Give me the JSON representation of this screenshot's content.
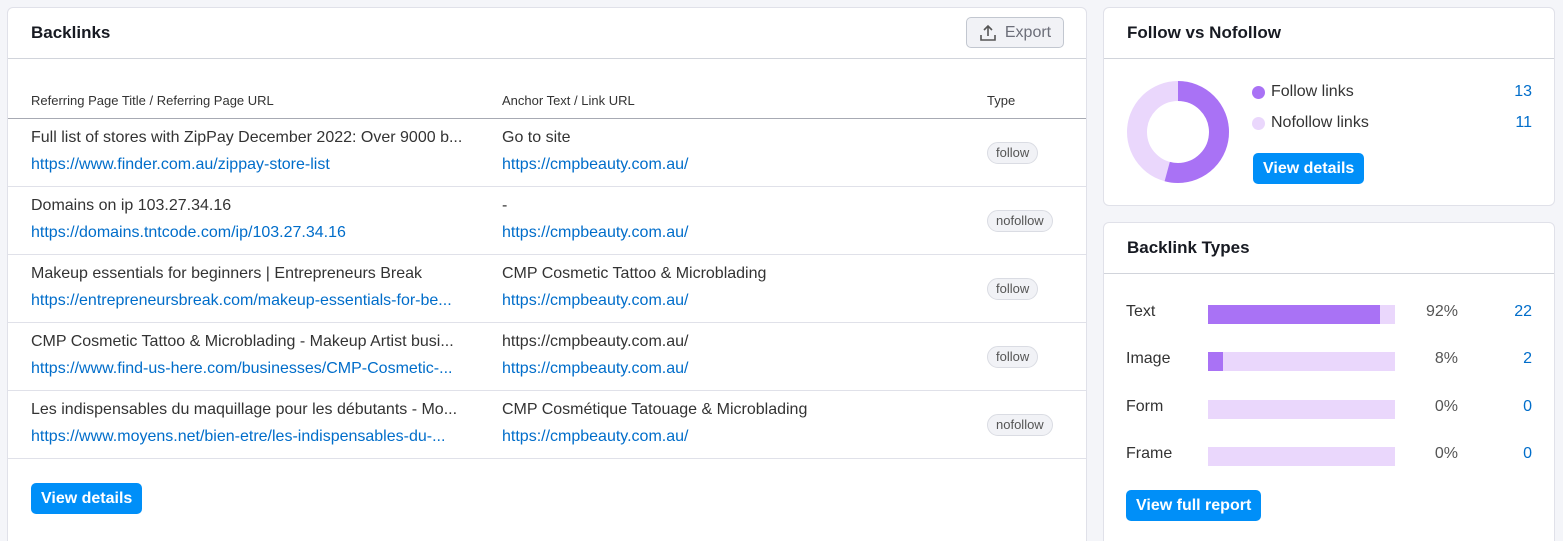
{
  "backlinks": {
    "title": "Backlinks",
    "export_label": "Export",
    "columns": [
      "Referring Page Title / Referring Page URL",
      "Anchor Text / Link URL",
      "Type"
    ],
    "rows": [
      {
        "title": "Full list of stores with ZipPay December 2022: Over 9000 b...",
        "url": "https://www.finder.com.au/zippay-store-list",
        "anchor": "Go to site",
        "link": "https://cmpbeauty.com.au/",
        "type": "follow"
      },
      {
        "title": "Domains on ip 103.27.34.16",
        "url": "https://domains.tntcode.com/ip/103.27.34.16",
        "anchor": "-",
        "link": "https://cmpbeauty.com.au/",
        "type": "nofollow"
      },
      {
        "title": "Makeup essentials for beginners | Entrepreneurs Break",
        "url": "https://entrepreneursbreak.com/makeup-essentials-for-be...",
        "anchor": "CMP Cosmetic Tattoo & Microblading",
        "link": "https://cmpbeauty.com.au/",
        "type": "follow"
      },
      {
        "title": "CMP Cosmetic Tattoo & Microblading - Makeup Artist busi...",
        "url": "https://www.find-us-here.com/businesses/CMP-Cosmetic-...",
        "anchor": "https://cmpbeauty.com.au/",
        "link": "https://cmpbeauty.com.au/",
        "type": "follow"
      },
      {
        "title": "Les indispensables du maquillage pour les débutants - Mo...",
        "url": "https://www.moyens.net/bien-etre/les-indispensables-du-...",
        "anchor": "CMP Cosmétique Tatouage & Microblading",
        "link": "https://cmpbeauty.com.au/",
        "type": "nofollow"
      }
    ],
    "view_details": "View details"
  },
  "follow": {
    "title": "Follow vs Nofollow",
    "follow_label": "Follow links",
    "follow_value": "13",
    "nofollow_label": "Nofollow links",
    "nofollow_value": "11",
    "follow_color": "#a972f5",
    "nofollow_color": "#ead7fc",
    "view_details": "View details"
  },
  "types": {
    "title": "Backlink Types",
    "items": [
      {
        "label": "Text",
        "pct": "92%",
        "count": "22",
        "fraction": 0.92
      },
      {
        "label": "Image",
        "pct": "8%",
        "count": "2",
        "fraction": 0.08
      },
      {
        "label": "Form",
        "pct": "0%",
        "count": "0",
        "fraction": 0
      },
      {
        "label": "Frame",
        "pct": "0%",
        "count": "0",
        "fraction": 0
      }
    ],
    "view_full": "View full report"
  },
  "icons": {
    "export": "upload-icon"
  }
}
